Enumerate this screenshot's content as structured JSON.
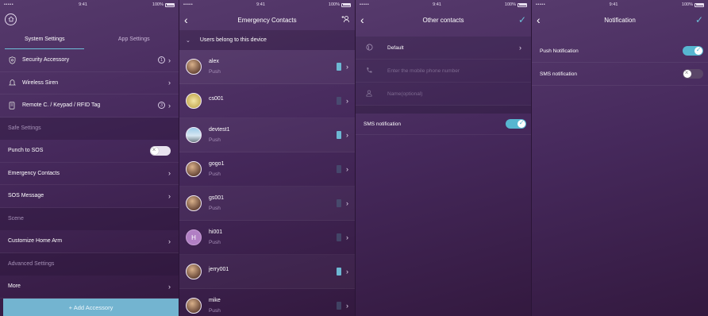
{
  "status": {
    "s1": {
      "carrier": "••••• ",
      "time": "9:41",
      "battery": "100%"
    },
    "s2": {
      "carrier": "••••• ",
      "time": "9:41",
      "battery": "100%"
    },
    "s3": {
      "carrier": "••••• ",
      "time": "9:41",
      "battery": "100%"
    },
    "s4": {
      "carrier": "••••• ",
      "time": "9:41",
      "battery": "100%"
    }
  },
  "settings": {
    "tabs": [
      "System Settings",
      "App Settings"
    ],
    "accessories": [
      {
        "label": "Security Accessory",
        "count": "1"
      },
      {
        "label": "Wireless Siren",
        "count": ""
      },
      {
        "label": "Remote C. / Keypad / RFID Tag",
        "count": "3"
      }
    ],
    "safe_header": "Safe Settings",
    "punch_label": "Punch to SOS",
    "emergency_label": "Emergency Contacts",
    "sos_message_label": "SOS Message",
    "scene_header": "Scene",
    "customize_label": "Customize Home Arm",
    "advanced_header": "Advanced Settings",
    "more_label": "More",
    "add_button": "+  Add Accessory"
  },
  "emergency": {
    "title": "Emergency Contacts",
    "users_header": "Users belong to this device",
    "contacts": [
      {
        "name": "alex",
        "sub": "Push",
        "active": true
      },
      {
        "name": "cs001",
        "sub": "",
        "active": false
      },
      {
        "name": "devtest1",
        "sub": "Push",
        "active": true
      },
      {
        "name": "gogo1",
        "sub": "Push",
        "active": false
      },
      {
        "name": "gs001",
        "sub": "Push",
        "active": false
      },
      {
        "name": "hi001",
        "sub": "Push",
        "active": false,
        "letter": "H"
      },
      {
        "name": "jerry001",
        "sub": "",
        "active": true
      },
      {
        "name": "mike",
        "sub": "Push",
        "active": false
      }
    ]
  },
  "other": {
    "title": "Other contacts",
    "country_default": "Default",
    "phone_placeholder": "Enter the mobile phone number",
    "name_placeholder": "Name(optional)",
    "sms_label": "SMS notification"
  },
  "notification": {
    "title": "Notification",
    "push_label": "Push Notification",
    "sms_label": "SMS notification"
  },
  "colors": {
    "accent": "#6ec0d9",
    "toggle_on": "#57b6d0",
    "add_bar": "#73b4d0"
  }
}
